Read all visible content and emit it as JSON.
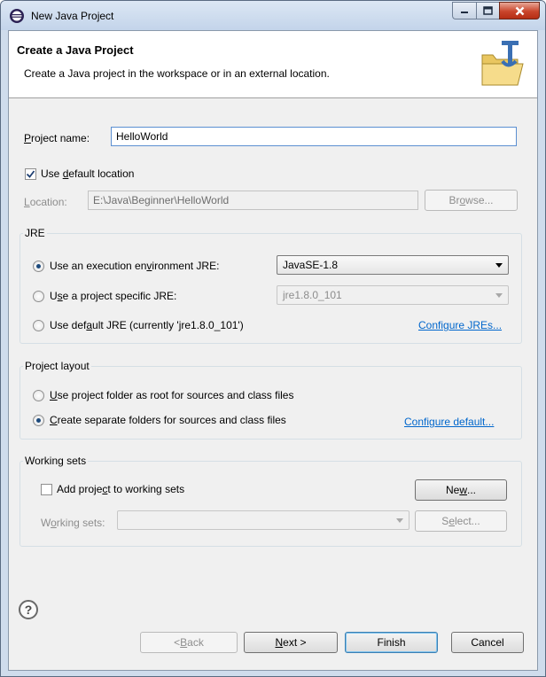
{
  "window": {
    "title": "New Java Project",
    "app_icon": "eclipse-icon",
    "caption_buttons": [
      "minimize",
      "maximize",
      "close"
    ]
  },
  "header": {
    "title": "Create a Java Project",
    "description": "Create a Java project in the workspace or in an external location.",
    "icon": "new-java-project-folder-icon"
  },
  "project_name": {
    "label_u": "P",
    "label_rest": "roject name:",
    "value": "HelloWorld"
  },
  "default_location": {
    "checked": true,
    "label_pre": "Use ",
    "label_u": "d",
    "label_rest": "efault location"
  },
  "location": {
    "label_u": "L",
    "label_rest": "ocation:",
    "value": "E:\\Java\\Beginner\\HelloWorld",
    "browse_pre": "Br",
    "browse_u": "o",
    "browse_rest": "wse..."
  },
  "jre": {
    "group_title": "JRE",
    "options": [
      {
        "pre": "Use an execution en",
        "u": "v",
        "rest": "ironment JRE:",
        "selected": true
      },
      {
        "pre": "U",
        "u": "s",
        "rest": "e a project specific JRE:",
        "selected": false
      },
      {
        "pre": "Use def",
        "u": "a",
        "rest": "ult JRE (currently 'jre1.8.0_101')",
        "selected": false
      }
    ],
    "env_select_value": "JavaSE-1.8",
    "specific_select_value": "jre1.8.0_101",
    "configure_link": "Configure JREs..."
  },
  "layout": {
    "group_title": "Project layout",
    "options": [
      {
        "u": "U",
        "rest": "se project folder as root for sources and class files",
        "selected": false
      },
      {
        "u": "C",
        "rest": "reate separate folders for sources and class files",
        "selected": true
      }
    ],
    "configure_link": "Configure default..."
  },
  "working_sets": {
    "group_title": "Working sets",
    "add_checked": false,
    "add_pre": "Add proje",
    "add_u": "c",
    "add_rest": "t to working sets",
    "new_pre": "Ne",
    "new_u": "w",
    "new_rest": "...",
    "label_pre": "W",
    "label_u": "o",
    "label_rest": "rking sets:",
    "select_pre": "S",
    "select_u": "e",
    "select_rest": "lect..."
  },
  "footer": {
    "help_glyph": "?",
    "back_pre": "< ",
    "back_u": "B",
    "back_rest": "ack",
    "next_u": "N",
    "next_rest": "ext >",
    "finish": "Finish",
    "cancel": "Cancel"
  }
}
